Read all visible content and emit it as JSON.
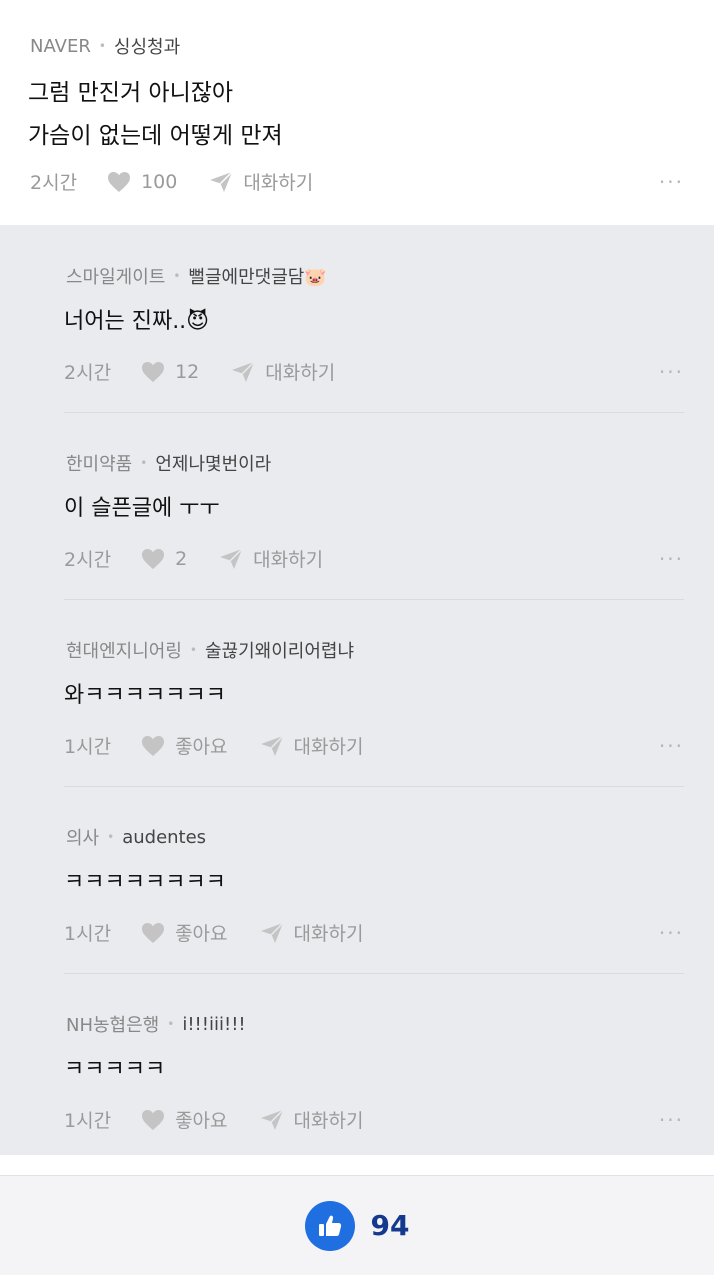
{
  "post": {
    "source": "NAVER",
    "author": "싱싱청과",
    "lines": [
      "그럼 만진거 아니잖아",
      "가슴이 없는데 어떻게 만져"
    ],
    "time": "2시간",
    "likes": "100",
    "reply_label": "대화하기",
    "more": "···"
  },
  "replies": [
    {
      "company": "스마일게이트",
      "author": "뻘글에만댓글담🐷",
      "text": "너어는 진짜..😈",
      "time": "2시간",
      "likes": "12",
      "reply_label": "대화하기",
      "more": "···"
    },
    {
      "company": "한미약품",
      "author": "언제나몇번이라",
      "text": "이 슬픈글에 ㅜㅜ",
      "time": "2시간",
      "likes": "2",
      "reply_label": "대화하기",
      "more": "···"
    },
    {
      "company": "현대엔지니어링",
      "author": "술끊기왜이리어렵냐",
      "text": "와ㅋㅋㅋㅋㅋㅋㅋ",
      "time": "1시간",
      "likes": "좋아요",
      "reply_label": "대화하기",
      "more": "···"
    },
    {
      "company": "의사",
      "author": "audentes",
      "text": "ㅋㅋㅋㅋㅋㅋㅋㅋ",
      "time": "1시간",
      "likes": "좋아요",
      "reply_label": "대화하기",
      "more": "···"
    },
    {
      "company": "NH농협은행",
      "author": "i!!!iii!!!",
      "text": "ㅋㅋㅋㅋㅋ",
      "time": "1시간",
      "likes": "좋아요",
      "reply_label": "대화하기",
      "more": "···"
    }
  ],
  "footer": {
    "like_count": "94"
  },
  "icons": {
    "heart": "heart-icon",
    "send": "send-icon",
    "thumbs": "thumbs-up-icon",
    "more": "more-dots-icon"
  },
  "colors": {
    "accent": "#1f6fe0",
    "count": "#14398f",
    "reply_bg": "#e9ebef"
  }
}
